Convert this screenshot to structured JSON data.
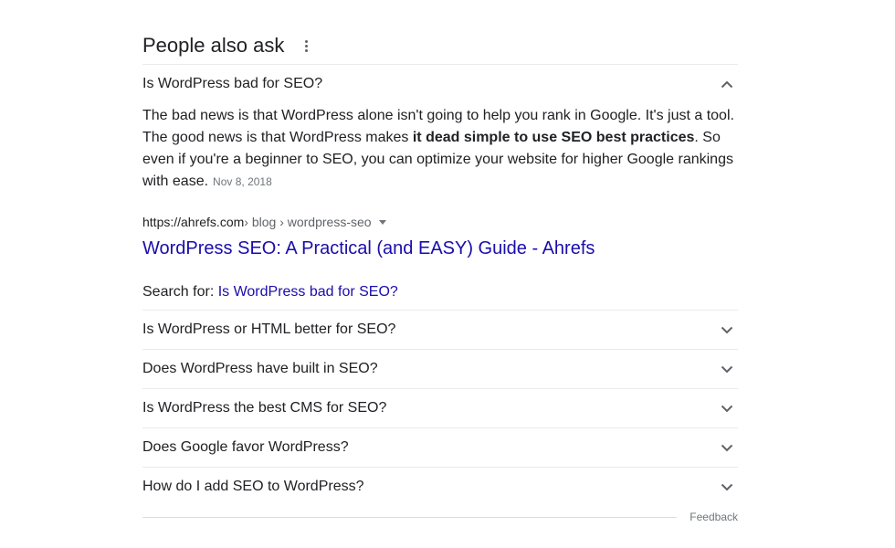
{
  "header": {
    "title": "People also ask",
    "menu_icon": "more-vert-icon"
  },
  "expanded": {
    "question": "Is WordPress bad for SEO?",
    "answer_part1": "The bad news is that WordPress alone isn't going to help you rank in Google. It's just a tool. The good news is that WordPress makes ",
    "answer_bold": "it dead simple to use SEO best practices",
    "answer_part2": ". So even if you're a beginner to SEO, you can optimize your website for higher Google rankings with ease.",
    "date": "Nov 8, 2018",
    "source_domain": "https://ahrefs.com",
    "source_path": " › blog › wordpress-seo",
    "result_title": "WordPress SEO: A Practical (and EASY) Guide - Ahrefs",
    "search_for_label": "Search for: ",
    "search_for_query": "Is WordPress bad for SEO?"
  },
  "questions": [
    "Is WordPress or HTML better for SEO?",
    "Does WordPress have built in SEO?",
    "Is WordPress the best CMS for SEO?",
    "Does Google favor WordPress?",
    "How do I add SEO to WordPress?"
  ],
  "footer": {
    "feedback": "Feedback"
  },
  "colors": {
    "link": "#1a0dab",
    "text": "#202124",
    "muted": "#70757a",
    "divider": "#ebebeb"
  }
}
